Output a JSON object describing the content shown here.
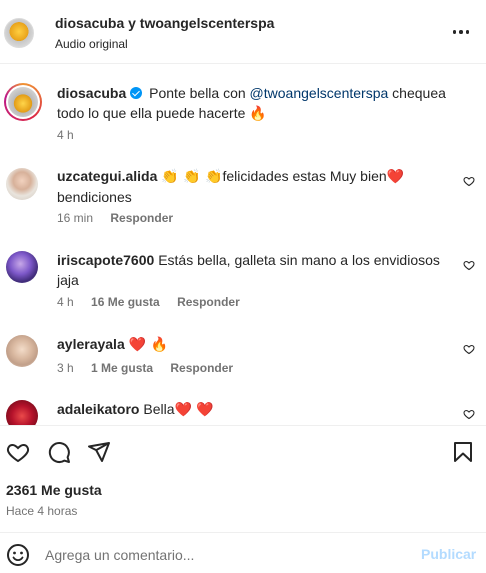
{
  "header": {
    "account_names": "diosacuba y twoangelscenterspa",
    "audio": "Audio original",
    "more_icon": "more-horizontal-icon"
  },
  "caption": {
    "username": "diosacuba",
    "verified": true,
    "text_prefix": "Ponte bella con ",
    "mention": "@twoangelscenterspa",
    "text_suffix": " chequea todo lo que ella puede hacerte",
    "emoji": "🔥",
    "time": "4 h"
  },
  "comments": [
    {
      "username": "uzcategui.alida",
      "emoji_prefix": "👏 👏 👏",
      "text": "felicidades estas Muy bien",
      "emoji_suffix": "❤️",
      "text2": " bendiciones",
      "time": "16 min",
      "likes": "",
      "reply": "Responder"
    },
    {
      "username": "iriscapote7600",
      "text": "Estás bella, galleta sin mano a los envidiosos jaja",
      "time": "4 h",
      "likes": "16 Me gusta",
      "reply": "Responder"
    },
    {
      "username": "aylerayala",
      "emoji_suffix": "❤️ 🔥",
      "time": "3 h",
      "likes": "1 Me gusta",
      "reply": "Responder"
    },
    {
      "username": "adaleikatoro",
      "text": "Bella",
      "emoji_suffix": "❤️ ❤️"
    }
  ],
  "actions": {
    "like_icon": "heart-icon",
    "comment_icon": "comment-icon",
    "share_icon": "share-icon",
    "save_icon": "bookmark-icon",
    "likes_count": "2361 Me gusta",
    "posted_ago": "Hace 4 horas"
  },
  "composer": {
    "emoji_icon": "emoji-icon",
    "placeholder": "Agrega un comentario...",
    "post_label": "Publicar"
  },
  "colors": {
    "text": "#262626",
    "secondary": "#737373",
    "mention": "#00376b",
    "verified": "#0095f6",
    "post_disabled": "#b3dbff"
  }
}
